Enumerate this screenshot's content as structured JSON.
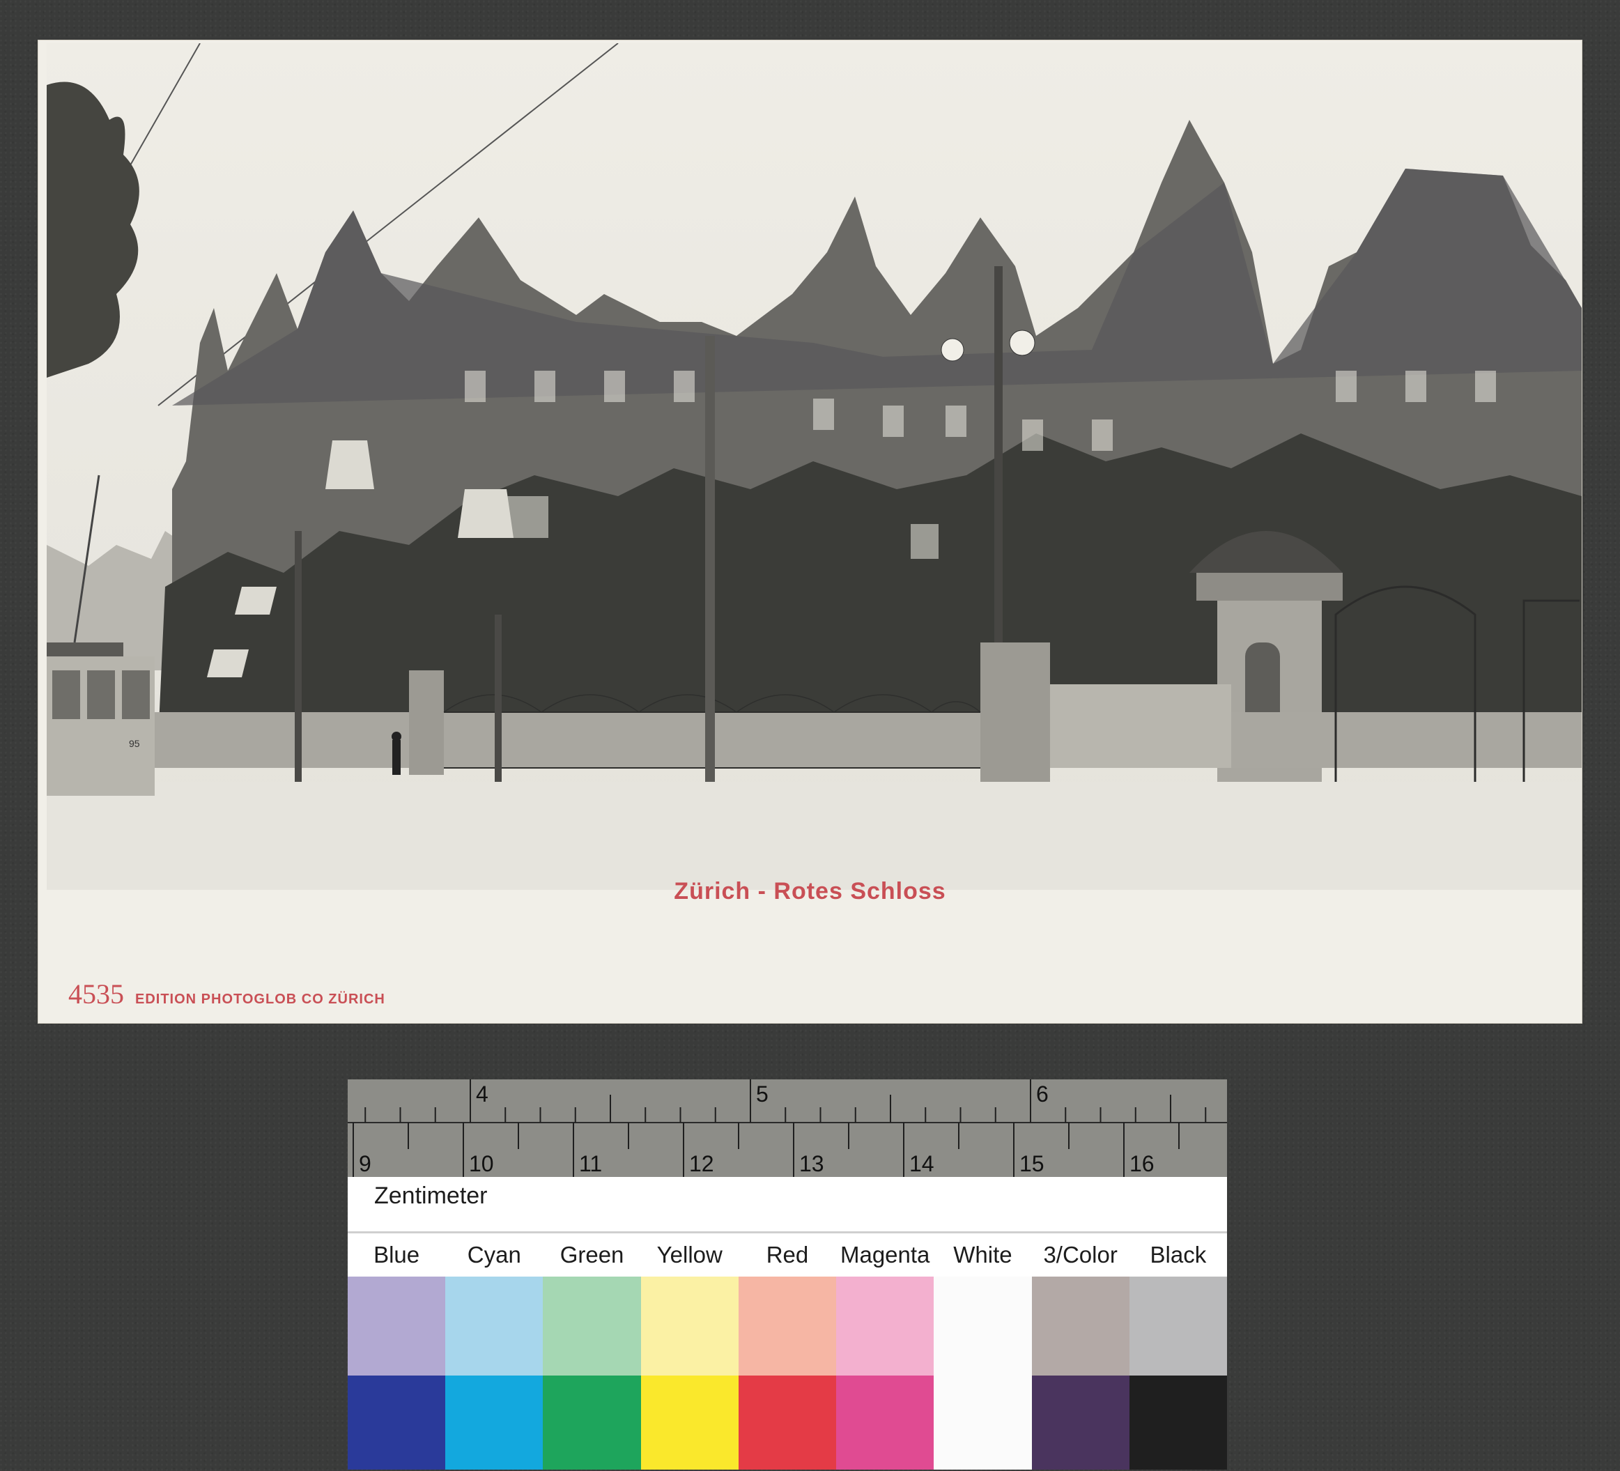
{
  "postcard": {
    "caption": "Zürich - Rotes Schloss",
    "edition_number": "4535",
    "edition_text": "EDITION PHOTOGLOB CO  ZÜRICH",
    "tram_number": "95"
  },
  "scale": {
    "inch_labels": [
      "4",
      "5",
      "6"
    ],
    "cm_labels": [
      "9",
      "10",
      "11",
      "12",
      "13",
      "14",
      "15",
      "16"
    ],
    "unit_label": "Zentimeter"
  },
  "color_patches": [
    {
      "name": "Blue",
      "light": "#b2a9d2",
      "dark": "#2a3a9a"
    },
    {
      "name": "Cyan",
      "light": "#a7d6ec",
      "dark": "#13a8de"
    },
    {
      "name": "Green",
      "light": "#a5d7b3",
      "dark": "#1ea55c"
    },
    {
      "name": "Yellow",
      "light": "#fbf1a4",
      "dark": "#fae82c"
    },
    {
      "name": "Red",
      "light": "#f6b6a4",
      "dark": "#e43b46"
    },
    {
      "name": "Magenta",
      "light": "#f3b0cf",
      "dark": "#e04b92"
    },
    {
      "name": "White",
      "light": "#fbfbfb",
      "dark": "#fbfbfb"
    },
    {
      "name": "3/Color",
      "light": "#b3a9a6",
      "dark": "#4a345e"
    },
    {
      "name": "Black",
      "light": "#bababb",
      "dark": "#1f1f1f"
    }
  ]
}
